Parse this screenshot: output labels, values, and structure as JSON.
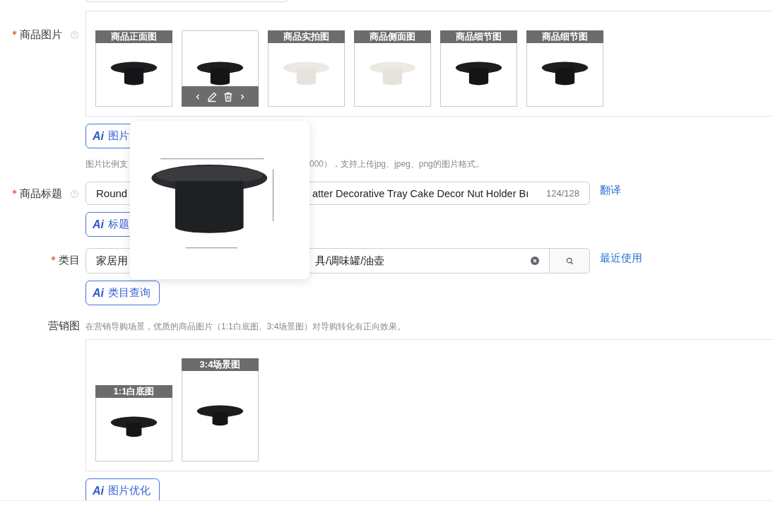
{
  "product_images": {
    "label": "商品图片",
    "required": true,
    "help": true,
    "images": [
      {
        "label": "商品正面图",
        "hovered": false
      },
      {
        "hovered": true
      },
      {
        "label": "商品实拍图",
        "hovered": false
      },
      {
        "label": "商品侧面图",
        "hovered": false
      },
      {
        "label": "商品细节图",
        "hovered": false
      },
      {
        "label": "商品细节图",
        "hovered": false
      }
    ],
    "ai_button": {
      "badge": "Ai",
      "label": "图片"
    },
    "hint_parts": [
      "图片比例支",
      "000），支持上传jpg、jpeg、png的图片格式。"
    ]
  },
  "title": {
    "label": "商品标题",
    "required": true,
    "help": true,
    "value_parts": [
      "Round",
      "atter Decorative Tray Cake Decor Nut Holder Bı"
    ],
    "counter": "124/128",
    "link": "翻译",
    "ai_button": {
      "badge": "Ai",
      "label": "标题"
    }
  },
  "category": {
    "label": "类目",
    "required": true,
    "value_parts": [
      "家居用",
      "具/调味罐/油壶"
    ],
    "clearable": true,
    "link": "最近使用",
    "ai_button": {
      "badge": "Ai",
      "label": "类目查询"
    }
  },
  "marketing": {
    "label": "营销图",
    "hint": "在营销导购场景，优质的商品图片（1:1白底图、3:4场景图）对导购转化有正向效果。",
    "images": [
      {
        "label": "1:1白底图"
      },
      {
        "label": "3:4场景图"
      }
    ],
    "ai_button": {
      "badge": "Ai",
      "label": "图片优化"
    }
  },
  "preview_popover": {
    "open": true
  }
}
